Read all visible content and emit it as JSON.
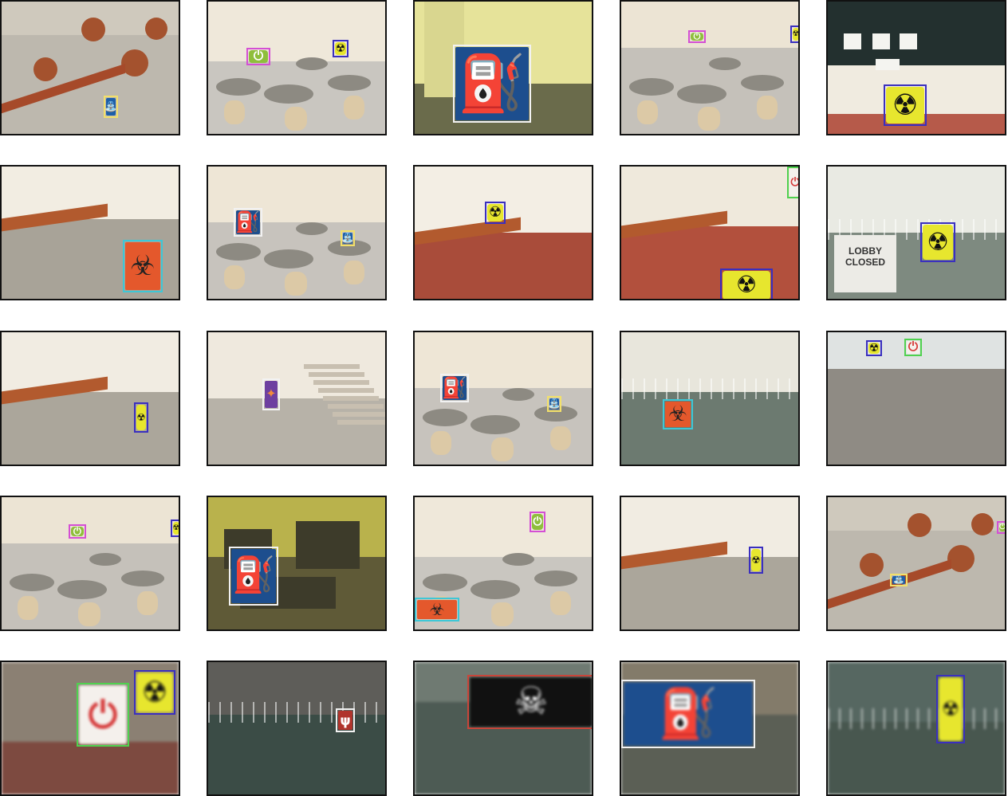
{
  "figure": {
    "rows": 5,
    "cols": 5
  },
  "colors": {
    "frame_border": "#111111",
    "box_radiation": "#3a2fbf",
    "box_fuel": "#f2f2f2",
    "box_biohazard": "#3ec7d6",
    "box_power": "#4fd14f",
    "box_skull": "#c9453a",
    "box_water": "#f2e06a",
    "box_plant": "#d44fd4",
    "box_pink": "#e060e0"
  },
  "cells": [
    {
      "scene": "atrium-overhead",
      "signs": [
        {
          "type": "water",
          "box": "box_water"
        }
      ]
    },
    {
      "scene": "cafe",
      "signs": [
        {
          "type": "plant",
          "box": "box_plant"
        },
        {
          "type": "radiation",
          "box": "box_radiation"
        }
      ]
    },
    {
      "scene": "office-yellow",
      "signs": [
        {
          "type": "fuel",
          "box": "box_fuel"
        }
      ]
    },
    {
      "scene": "cafe-wide",
      "signs": [
        {
          "type": "plant",
          "box": "box_plant"
        },
        {
          "type": "radiation",
          "box": "box_radiation"
        }
      ]
    },
    {
      "scene": "bulletin",
      "signs": [
        {
          "type": "radiation",
          "box": "box_radiation"
        }
      ]
    },
    {
      "scene": "corridor",
      "signs": [
        {
          "type": "biohazard",
          "box": "box_biohazard"
        }
      ]
    },
    {
      "scene": "lobby",
      "signs": [
        {
          "type": "fuel",
          "box": "box_fuel"
        },
        {
          "type": "water",
          "box": "box_water"
        }
      ]
    },
    {
      "scene": "balcony",
      "signs": [
        {
          "type": "radiation",
          "box": "box_radiation"
        }
      ]
    },
    {
      "scene": "balcony-wide",
      "signs": [
        {
          "type": "radiation",
          "box": "box_radiation"
        },
        {
          "type": "power",
          "box": "box_power"
        }
      ]
    },
    {
      "scene": "stairwell",
      "signs": [
        {
          "type": "radiation",
          "box": "box_radiation"
        }
      ],
      "caption_lines": [
        "LOBBY",
        "CLOSED"
      ]
    },
    {
      "scene": "hall",
      "signs": [
        {
          "type": "radiation",
          "box": "box_radiation"
        }
      ]
    },
    {
      "scene": "stairs",
      "signs": [
        {
          "type": "purple",
          "box": "box_fuel"
        }
      ]
    },
    {
      "scene": "lobby",
      "signs": [
        {
          "type": "fuel",
          "box": "box_fuel"
        },
        {
          "type": "water",
          "box": "box_water"
        }
      ]
    },
    {
      "scene": "railing",
      "signs": [
        {
          "type": "biohazard",
          "box": "box_biohazard"
        }
      ]
    },
    {
      "scene": "open-floor",
      "signs": [
        {
          "type": "radiation",
          "box": "box_radiation"
        },
        {
          "type": "power",
          "box": "box_power"
        }
      ]
    },
    {
      "scene": "cafe-wide",
      "signs": [
        {
          "type": "plant",
          "box": "box_plant"
        },
        {
          "type": "radiation",
          "box": "box_radiation"
        }
      ]
    },
    {
      "scene": "lab",
      "signs": [
        {
          "type": "fuel",
          "box": "box_fuel"
        }
      ]
    },
    {
      "scene": "cafe",
      "signs": [
        {
          "type": "plant",
          "box": "box_plant"
        },
        {
          "type": "biohazard",
          "box": "box_biohazard"
        }
      ]
    },
    {
      "scene": "hall",
      "signs": [
        {
          "type": "radiation",
          "box": "box_radiation"
        }
      ]
    },
    {
      "scene": "atrium-overhead",
      "signs": [
        {
          "type": "water",
          "box": "box_water"
        },
        {
          "type": "plant",
          "box": "box_plant"
        }
      ]
    },
    {
      "scene": "closeup-power",
      "signs": [
        {
          "type": "power",
          "box": "box_power"
        },
        {
          "type": "radiation",
          "box": "box_radiation"
        }
      ]
    },
    {
      "scene": "court",
      "signs": [
        {
          "type": "fork",
          "box": "box_fuel"
        }
      ]
    },
    {
      "scene": "closeup-skull",
      "signs": [
        {
          "type": "skull",
          "box": "box_skull"
        }
      ]
    },
    {
      "scene": "closeup-fuel",
      "signs": [
        {
          "type": "fuel",
          "box": "box_fuel"
        }
      ]
    },
    {
      "scene": "court-close",
      "signs": [
        {
          "type": "radiation",
          "box": "box_radiation"
        }
      ]
    }
  ]
}
